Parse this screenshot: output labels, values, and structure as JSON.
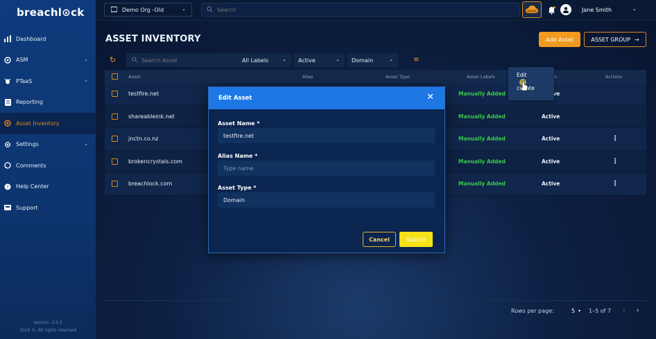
{
  "app": {
    "logo": "breachl⊙ck"
  },
  "sidebar": {
    "items": [
      {
        "label": "Dashboard",
        "icon": "bar-chart-icon",
        "chev": ""
      },
      {
        "label": "ASM",
        "icon": "radar-icon",
        "chev": "⌄"
      },
      {
        "label": "PTaaS",
        "icon": "bug-icon",
        "chev": "⌄"
      },
      {
        "label": "Reporting",
        "icon": "document-icon",
        "chev": ""
      },
      {
        "label": "Asset Inventory",
        "icon": "circle-dot-icon",
        "chev": ""
      },
      {
        "label": "Settings",
        "icon": "gear-icon",
        "chev": "⌄"
      },
      {
        "label": "Comments",
        "icon": "chat-icon",
        "chev": ""
      },
      {
        "label": "Help Center",
        "icon": "help-icon",
        "chev": ""
      },
      {
        "label": "Support",
        "icon": "support-icon",
        "chev": ""
      }
    ],
    "version": "Version: 2.0.3",
    "copyright": "2024 ©. All rights reserved"
  },
  "topbar": {
    "org": "Demo Org -Old",
    "search_placeholder": "Search",
    "user": "Jane Smith"
  },
  "page": {
    "title": "ASSET INVENTORY",
    "add_asset": "Add Asset",
    "asset_group": "ASSET GROUP"
  },
  "filters": {
    "search_placeholder": "Search Asset",
    "labels": "All Labels",
    "status": "Active",
    "type": "Domain"
  },
  "table": {
    "headers": {
      "asset": "Asset",
      "alias": "Alias",
      "type": "Asset Type",
      "labels": "Asset Labels",
      "status": "Status",
      "actions": "Actions"
    },
    "rows": [
      {
        "asset": "testfire.net",
        "label": "Manually Added",
        "status": "Active"
      },
      {
        "asset": "shareableink.net",
        "label": "Manually Added",
        "status": "Active"
      },
      {
        "asset": "jnctn.co.nz",
        "label": "Manually Added",
        "status": "Active"
      },
      {
        "asset": "brokencrystals.com",
        "label": "Manually Added",
        "status": "Active"
      },
      {
        "asset": "breachlock.com",
        "label": "Manually Added",
        "status": "Active"
      }
    ]
  },
  "row_menu": {
    "edit": "Edit",
    "deactivate": "Deactivate",
    "deactivate_visible": "ctivate"
  },
  "pagination": {
    "rows_per_page_label": "Rows per page:",
    "rows_per_page": "5",
    "range": "1–5 of 7"
  },
  "modal": {
    "title": "Edit Asset",
    "asset_name_label": "Asset Name *",
    "asset_name_value": "testfire.net",
    "alias_label": "Alias Name *",
    "alias_placeholder": "Type name",
    "type_label": "Asset Type *",
    "type_value": "Domain",
    "cancel": "Cancel",
    "submit": "Submit"
  },
  "colors": {
    "accent": "#f29a1f",
    "modal_header": "#1d78e6",
    "label_green": "#39c94a",
    "submit": "#f7e118"
  }
}
